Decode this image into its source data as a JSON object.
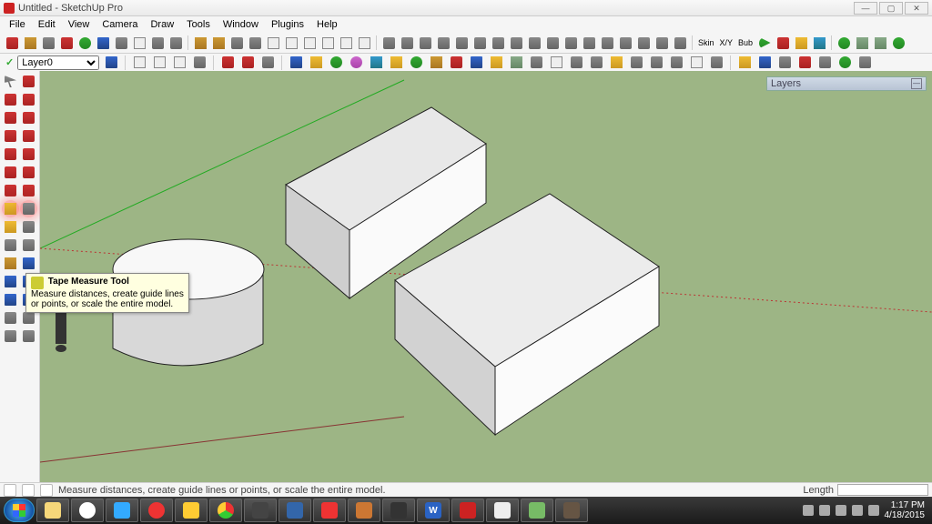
{
  "window": {
    "title": "Untitled - SketchUp Pro"
  },
  "menu": [
    "File",
    "Edit",
    "View",
    "Camera",
    "Draw",
    "Tools",
    "Window",
    "Plugins",
    "Help"
  ],
  "layer_current": "Layer0",
  "tooltip": {
    "title": "Tape Measure Tool",
    "body": "Measure distances, create guide lines or points, or scale the entire model."
  },
  "layers_panel_title": "Layers",
  "status": {
    "hint": "Measure distances, create guide lines or points, or scale the entire model.",
    "length_label": "Length",
    "length_value": ""
  },
  "tray": {
    "time": "1:17 PM",
    "date": "4/18/2015"
  },
  "skin_labels": [
    "Skin",
    "X/Y",
    "Bub"
  ],
  "colors": {
    "viewport_bg": "#9db585"
  }
}
